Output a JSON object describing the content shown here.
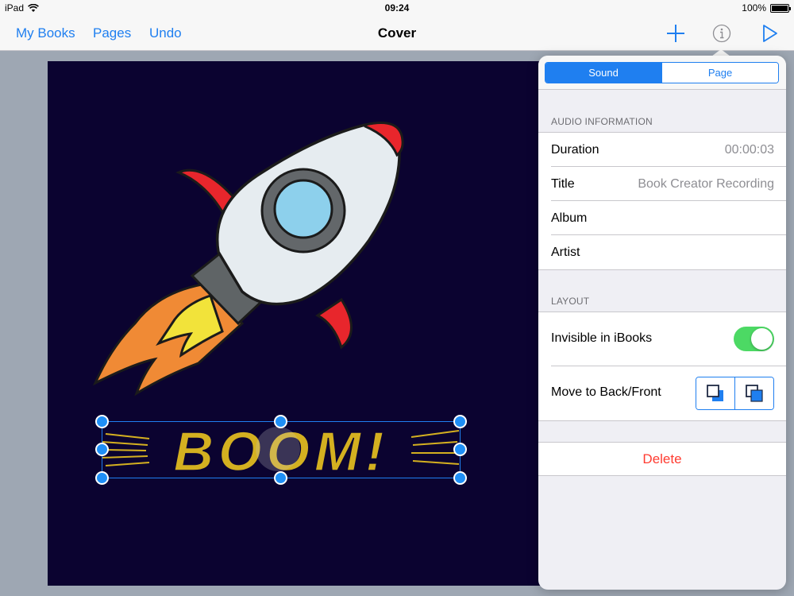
{
  "status_bar": {
    "device": "iPad",
    "time": "09:24",
    "battery": "100%"
  },
  "nav": {
    "my_books": "My Books",
    "pages": "Pages",
    "undo": "Undo",
    "title": "Cover",
    "icons": [
      "plus-icon",
      "info-icon",
      "play-icon"
    ]
  },
  "canvas": {
    "background_color": "#0b0330",
    "text_art": "BOOM!",
    "text_art_color": "#d4b020",
    "accent_color": "#1f7ff0"
  },
  "popover": {
    "tabs": [
      {
        "label": "Sound",
        "active": true
      },
      {
        "label": "Page",
        "active": false
      }
    ],
    "audio_section": {
      "header": "AUDIO INFORMATION",
      "rows": [
        {
          "label": "Duration",
          "value": "00:00:03"
        },
        {
          "label": "Title",
          "value": "Book Creator Recording"
        },
        {
          "label": "Album",
          "value": ""
        },
        {
          "label": "Artist",
          "value": ""
        }
      ]
    },
    "layout_section": {
      "header": "LAYOUT",
      "invisible_label": "Invisible in iBooks",
      "invisible_on": true,
      "move_label": "Move to Back/Front"
    },
    "delete_label": "Delete",
    "delete_color": "#ff3b30",
    "toggle_color": "#4cd964"
  }
}
